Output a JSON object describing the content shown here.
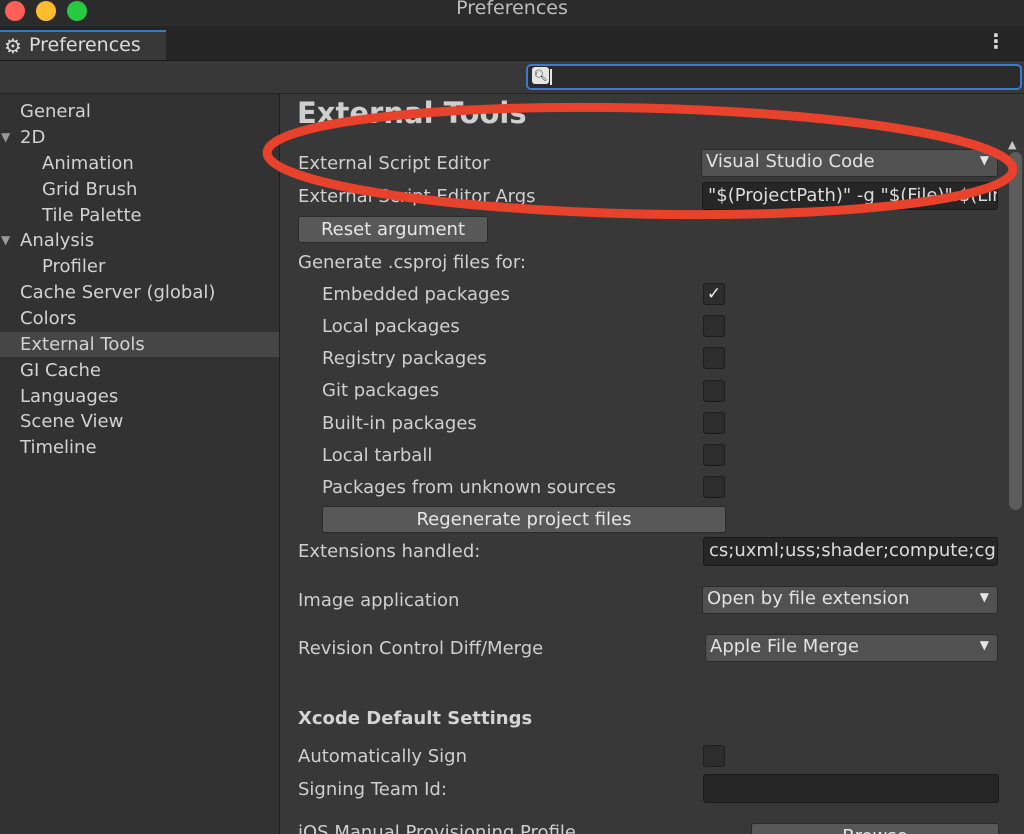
{
  "window": {
    "title": "Preferences"
  },
  "tab": {
    "label": "Preferences",
    "icon": "gear-icon"
  },
  "search": {
    "value": "",
    "placeholder": ""
  },
  "sidebar": {
    "items": [
      {
        "label": "General"
      },
      {
        "label": "2D",
        "expanded": true
      },
      {
        "label": "Animation"
      },
      {
        "label": "Grid Brush"
      },
      {
        "label": "Tile Palette"
      },
      {
        "label": "Analysis",
        "expanded": true
      },
      {
        "label": "Profiler"
      },
      {
        "label": "Cache Server (global)"
      },
      {
        "label": "Colors"
      },
      {
        "label": "External Tools",
        "selected": true
      },
      {
        "label": "GI Cache"
      },
      {
        "label": "Languages"
      },
      {
        "label": "Scene View"
      },
      {
        "label": "Timeline"
      }
    ]
  },
  "main": {
    "title": "External Tools",
    "external_script_editor": {
      "label": "External Script Editor",
      "value": "Visual Studio Code"
    },
    "external_script_editor_args": {
      "label": "External Script Editor Args",
      "value": "\"$(ProjectPath)\" -g \"$(File)\":$(Line):$(Column)"
    },
    "reset_argument": "Reset argument",
    "generate_csproj": {
      "label": "Generate .csproj files for:",
      "options": [
        {
          "label": "Embedded packages",
          "checked": true
        },
        {
          "label": "Local packages",
          "checked": false
        },
        {
          "label": "Registry packages",
          "checked": false
        },
        {
          "label": "Git packages",
          "checked": false
        },
        {
          "label": "Built-in packages",
          "checked": false
        },
        {
          "label": "Local tarball",
          "checked": false
        },
        {
          "label": "Packages from unknown sources",
          "checked": false
        }
      ],
      "check_mark": "✓"
    },
    "regenerate": "Regenerate project files",
    "extensions_handled": {
      "label": "Extensions handled:",
      "value": "cs;uxml;uss;shader;compute;cginc;hlsl;glslinc;template;raytrace"
    },
    "image_application": {
      "label": "Image application",
      "value": "Open by file extension"
    },
    "revision_control": {
      "label": "Revision Control Diff/Merge",
      "value": "Apple File Merge"
    },
    "xcode": {
      "heading": "Xcode Default Settings",
      "automatically_sign": {
        "label": "Automatically Sign",
        "checked": false
      },
      "signing_team_id": {
        "label": "Signing Team Id:",
        "value": ""
      },
      "ios_profile": {
        "label": "iOS Manual Provisioning Profile",
        "browse": "Browse"
      }
    }
  },
  "annotation": {
    "color": "#e8412c",
    "shape": "ellipse"
  }
}
